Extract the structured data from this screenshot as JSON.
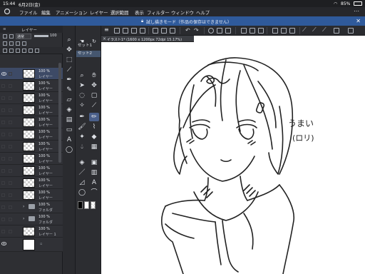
{
  "status": {
    "time": "15:44",
    "date": "6月2日(金)",
    "battery": "85%"
  },
  "menu": [
    "ファイル",
    "編集",
    "アニメーション",
    "レイヤー",
    "選択範囲",
    "表示",
    "フィルター",
    "ウィンドウ",
    "ヘルプ"
  ],
  "banner": {
    "text": "試し描きモード（作品の保存はできません）"
  },
  "layer_panel": {
    "title": "レイヤー",
    "blend_mode": "通常",
    "opacity": "100",
    "layers": [
      {
        "opacity": "100 %",
        "name": "レイヤー",
        "kind": "raster",
        "selected": true,
        "visible": true
      },
      {
        "opacity": "100 %",
        "name": "レイヤー",
        "kind": "raster"
      },
      {
        "opacity": "100 %",
        "name": "レイヤー",
        "kind": "raster"
      },
      {
        "opacity": "100 %",
        "name": "レイヤー",
        "kind": "raster"
      },
      {
        "opacity": "100 %",
        "name": "レイヤー",
        "kind": "raster"
      },
      {
        "opacity": "100 %",
        "name": "レイヤー",
        "kind": "raster"
      },
      {
        "opacity": "100 %",
        "name": "レイヤー",
        "kind": "raster"
      },
      {
        "opacity": "100 %",
        "name": "レイヤー",
        "kind": "raster"
      },
      {
        "opacity": "100 %",
        "name": "レイヤー",
        "kind": "raster"
      },
      {
        "opacity": "100 %",
        "name": "レイヤー",
        "kind": "raster"
      },
      {
        "opacity": "100 %",
        "name": "レイヤー",
        "kind": "raster"
      },
      {
        "opacity": "100 %",
        "name": "フォルダ",
        "kind": "folder"
      },
      {
        "opacity": "100 %",
        "name": "フォルダ",
        "kind": "folder"
      },
      {
        "opacity": "100 %",
        "name": "レイヤー 1",
        "kind": "raster"
      },
      {
        "opacity": "",
        "name": "",
        "kind": "paper",
        "visible": true
      }
    ]
  },
  "sub_tools": [
    "セット1",
    "セット2"
  ],
  "document_tab": "イラスト1* (1600 x 1200px 72dpi 15.17%)",
  "canvas": {
    "annotation_line1": "うまい",
    "annotation_line2": "(ロリ)"
  },
  "colors": {
    "accent": "#2f5a9b",
    "selected_tool": "#4a5f8a",
    "main_color": "#000000",
    "sub_color": "#ffffff"
  }
}
